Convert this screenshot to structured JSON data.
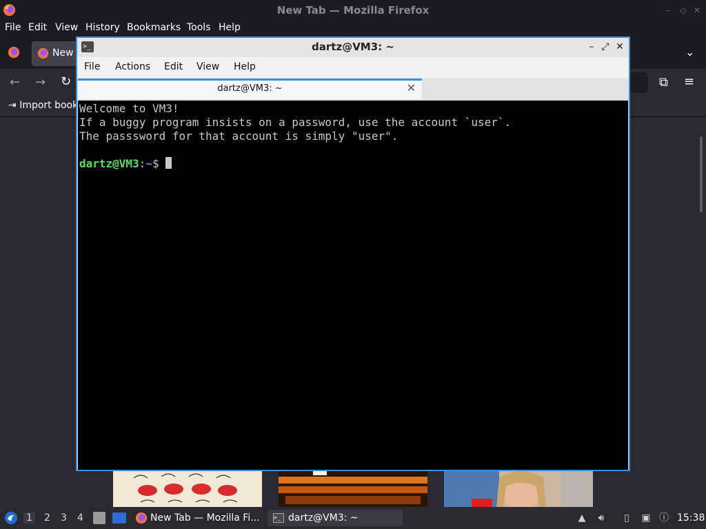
{
  "firefox": {
    "window_title": "New Tab — Mozilla Firefox",
    "menu": [
      "File",
      "Edit",
      "View",
      "History",
      "Bookmarks",
      "Tools",
      "Help"
    ],
    "tab_label": "New",
    "bookmark_label": "Import book"
  },
  "terminal": {
    "window_title": "dartz@VM3: ~",
    "menu": [
      "File",
      "Actions",
      "Edit",
      "View",
      "Help"
    ],
    "tab_label": "dartz@VM3: ~",
    "lines": [
      "Welcome to VM3!",
      "If a buggy program insists on a password, use the account `user`.",
      "The passsword for that account is simply \"user\"."
    ],
    "prompt": {
      "user_host": "dartz@VM3",
      "colon": ":",
      "path": "~",
      "symbol": "$ "
    }
  },
  "taskbar": {
    "workspaces": [
      "1",
      "2",
      "3",
      "4"
    ],
    "firefox_task": "New Tab — Mozilla Fi...",
    "terminal_task": "dartz@VM3: ~",
    "clock": "15:38"
  },
  "colors": {
    "accent": "#3d8fd8",
    "prompt_user": "#55e055",
    "prompt_path": "#5a8cff"
  }
}
